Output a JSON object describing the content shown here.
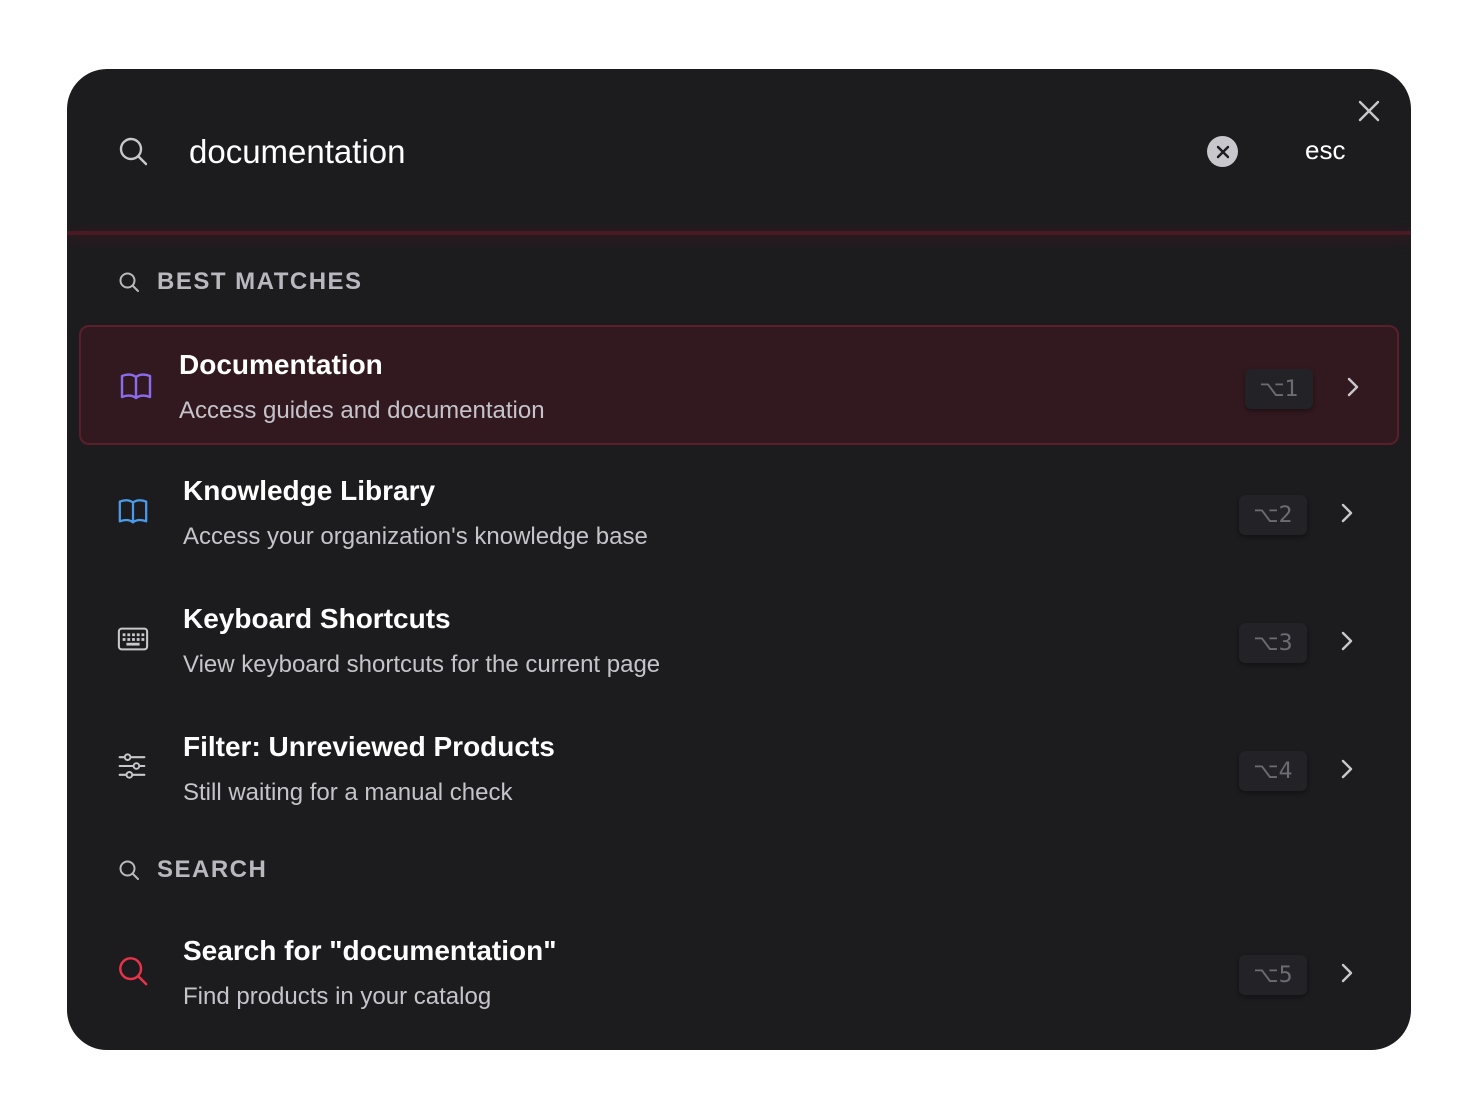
{
  "search": {
    "query": "documentation",
    "esc_label": "esc"
  },
  "sections": {
    "best_matches": "BEST MATCHES",
    "search": "SEARCH"
  },
  "items": [
    {
      "title": "Documentation",
      "desc": "Access guides and documentation",
      "shortcut": "⌥1",
      "icon": "book-open-icon",
      "icon_color": "#8b6cf0"
    },
    {
      "title": "Knowledge Library",
      "desc": "Access your organization's knowledge base",
      "shortcut": "⌥2",
      "icon": "book-open-icon",
      "icon_color": "#4a9be8"
    },
    {
      "title": "Keyboard Shortcuts",
      "desc": "View keyboard shortcuts for the current page",
      "shortcut": "⌥3",
      "icon": "keyboard-icon",
      "icon_color": "#c8c8cc"
    },
    {
      "title": "Filter: Unreviewed Products",
      "desc": "Still waiting for a manual check",
      "shortcut": "⌥4",
      "icon": "sliders-icon",
      "icon_color": "#c8c8cc"
    },
    {
      "title": "Search for \"documentation\"",
      "desc": "Find products in your catalog",
      "shortcut": "⌥5",
      "icon": "search-icon",
      "icon_color": "#e8334a"
    }
  ],
  "colors": {
    "background": "#1c1c1f",
    "active_bg": "#32191f",
    "accent": "#e8334a"
  }
}
